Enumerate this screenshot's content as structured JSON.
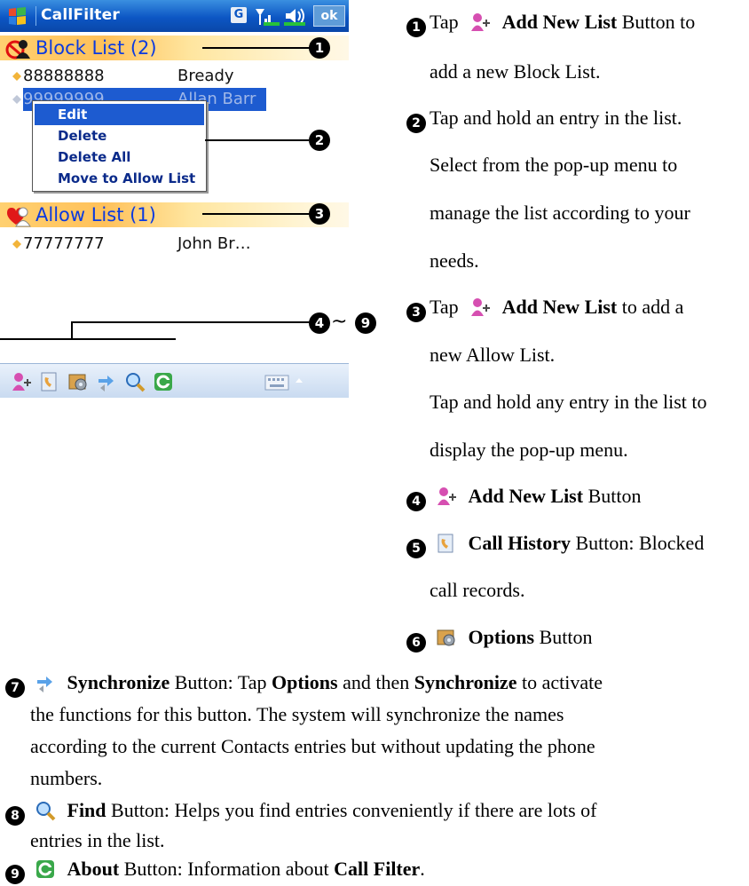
{
  "pda": {
    "app_title": "CallFilter",
    "indicators": {
      "network": "G",
      "ok": "ok"
    },
    "block_list": {
      "label": "Block List (2)",
      "entries": [
        {
          "number": "88888888",
          "name": "Bready"
        },
        {
          "number": "99999999",
          "name": "Allan Barr"
        }
      ]
    },
    "popup_menu": [
      "Edit",
      "Delete",
      "Delete All",
      "Move to Allow List"
    ],
    "allow_list": {
      "label": "Allow List (1)",
      "entries": [
        {
          "number": "77777777",
          "name": "John Br…"
        }
      ]
    },
    "toolbar_icons": [
      "add-new-list-icon",
      "call-history-icon",
      "options-icon",
      "synchronize-icon",
      "find-icon",
      "about-icon"
    ],
    "callouts": {
      "c1": "1",
      "c2": "2",
      "c3": "3",
      "c4": "4",
      "tilde": "~",
      "c9": "9"
    }
  },
  "instructions": {
    "i1": {
      "num": "1",
      "pre": "Tap",
      "bold": "Add New List",
      "post": "Button to",
      "line2": "add a new Block List."
    },
    "i2": {
      "num": "2",
      "line1": "Tap and hold an entry in the list.",
      "line2": "Select from the pop-up menu to",
      "line3": "manage the list according to your",
      "line4": "needs."
    },
    "i3": {
      "num": "3",
      "pre": "Tap",
      "bold": "Add New List",
      "post": "to add a",
      "line2": "new Allow List.",
      "line3": "Tap and hold any entry in the list to",
      "line4": "display the pop-up menu."
    },
    "i4": {
      "num": "4",
      "bold": "Add New List",
      "post": "Button"
    },
    "i5": {
      "num": "5",
      "bold": "Call History",
      "post": "Button: Blocked",
      "line2": "call records."
    },
    "i6": {
      "num": "6",
      "bold": "Options",
      "post": "Button"
    },
    "i7": {
      "num": "7",
      "bold": "Synchronize",
      "t1": "Button: Tap",
      "b2": "Options",
      "t2": "and then",
      "b3": "Synchronize",
      "t3": "to activate",
      "line2": "the functions for this button. The system will synchronize the names",
      "line3": "according to the current Contacts entries but without updating the phone",
      "line4": "numbers."
    },
    "i8": {
      "num": "8",
      "bold": "Find",
      "post": "Button: Helps you find entries conveniently if there are lots of",
      "line2": "entries in the list."
    },
    "i9": {
      "num": "9",
      "bold": "About",
      "post": "Button: Information about",
      "b2": "Call Filter",
      "end": "."
    }
  }
}
